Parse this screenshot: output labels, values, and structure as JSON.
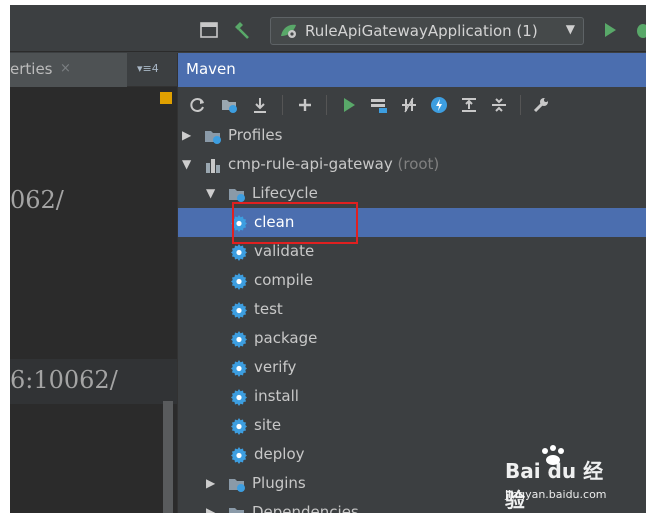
{
  "toolbar": {
    "run_config": "RuleApiGatewayApplication (1)",
    "icons": [
      "window-icon",
      "build-hammer-icon",
      "run-config-icon",
      "dropdown-arrow-icon",
      "run-icon",
      "debug-icon"
    ]
  },
  "left_panel": {
    "tab_label": "erties",
    "tab_close": "×",
    "menu": "▾≡4",
    "code_line_1": "062/",
    "code_line_2": "6:10062/"
  },
  "maven": {
    "title": "Maven",
    "toolbar_icons": [
      "refresh-icon",
      "reimport-icon",
      "download-icon",
      "add-icon",
      "run-icon",
      "execute-goal-icon",
      "toggle-offline-icon",
      "skip-tests-icon",
      "show-dependencies-icon",
      "collapse-all-icon",
      "settings-wrench-icon"
    ],
    "tree": [
      {
        "label": "Profiles",
        "depth": 0,
        "expanded": false
      },
      {
        "label": "cmp-rule-api-gateway",
        "suffix": " (root)",
        "depth": 0,
        "expanded": true
      },
      {
        "label": "Lifecycle",
        "depth": 1,
        "expanded": true
      },
      {
        "label": "clean",
        "depth": 2,
        "selected": true
      },
      {
        "label": "validate",
        "depth": 2
      },
      {
        "label": "compile",
        "depth": 2
      },
      {
        "label": "test",
        "depth": 2
      },
      {
        "label": "package",
        "depth": 2
      },
      {
        "label": "verify",
        "depth": 2
      },
      {
        "label": "install",
        "depth": 2
      },
      {
        "label": "site",
        "depth": 2
      },
      {
        "label": "deploy",
        "depth": 2
      },
      {
        "label": "Plugins",
        "depth": 1,
        "expanded": false
      },
      {
        "label": "Dependencies",
        "depth": 1,
        "expanded": false
      }
    ]
  },
  "watermark": {
    "brand": "Bai du 经验",
    "url": "jingyan.baidu.com"
  },
  "colors": {
    "selection": "#4b6eaf",
    "highlight_box": "#e02020",
    "gear": "#3d9ee0"
  }
}
